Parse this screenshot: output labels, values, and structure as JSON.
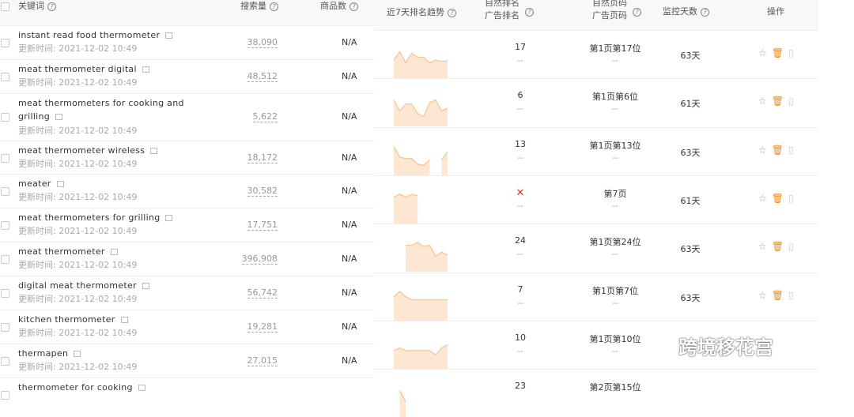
{
  "left_headers": {
    "keyword": "关键词",
    "volume": "搜索量",
    "products": "商品数"
  },
  "right_headers": {
    "trend": "近7天排名趋势",
    "rank1": "自然排名",
    "rank2": "广告排名",
    "page1": "自然页码",
    "page2": "广告页码",
    "days": "监控天数",
    "ops": "操作"
  },
  "help_glyph": "?",
  "update_label": "更新时间: 2021-12-02 10:49",
  "keywords": [
    {
      "kw": "instant read food thermometer",
      "vol": "38,090",
      "prod": "N/A"
    },
    {
      "kw": "meat thermometer digital",
      "vol": "48,512",
      "prod": "N/A"
    },
    {
      "kw": "meat thermometers for cooking and grilling",
      "vol": "5,622",
      "prod": "N/A"
    },
    {
      "kw": "meat thermometer wireless",
      "vol": "18,172",
      "prod": "N/A"
    },
    {
      "kw": "meater",
      "vol": "30,582",
      "prod": "N/A"
    },
    {
      "kw": "meat thermometers for grilling",
      "vol": "17,751",
      "prod": "N/A"
    },
    {
      "kw": "meat thermometer",
      "vol": "396,908",
      "prod": "N/A"
    },
    {
      "kw": "digital meat thermometer",
      "vol": "56,742",
      "prod": "N/A"
    },
    {
      "kw": "kitchen thermometer",
      "vol": "19,281",
      "prod": "N/A"
    },
    {
      "kw": "thermapen",
      "vol": "27,015",
      "prod": "N/A"
    },
    {
      "kw": "thermometer for cooking",
      "vol": "",
      "prod": ""
    }
  ],
  "rankings": [
    {
      "rank": "17",
      "ad": "--",
      "page": "第1页第17位",
      "adpage": "--",
      "days": "63天",
      "trend": [
        0.6,
        0.9,
        0.5,
        0.85,
        0.7,
        0.7,
        0.5,
        0.6,
        0.55,
        0.57
      ]
    },
    {
      "rank": "6",
      "ad": "--",
      "page": "第1页第6位",
      "adpage": "--",
      "days": "61天",
      "trend": [
        0.9,
        0.5,
        0.75,
        0.75,
        0.4,
        0.3,
        0.8,
        0.9,
        0.5,
        0.6
      ]
    },
    {
      "rank": "13",
      "ad": "--",
      "page": "第1页第13位",
      "adpage": "--",
      "days": "63天",
      "trend": [
        1,
        0.6,
        0.55,
        0.55,
        0.35,
        0.3,
        0.5,
        null,
        0.5,
        0.8
      ]
    },
    {
      "rank": "✕",
      "ad": "--",
      "page": "第7页",
      "adpage": "--",
      "days": "61天",
      "trend": [
        0.9,
        1,
        0.9,
        1,
        0.95,
        null,
        null,
        null,
        null,
        null
      ]
    },
    {
      "rank": "24",
      "ad": "--",
      "page": "第1页第24位",
      "adpage": "--",
      "days": "63天",
      "trend": [
        null,
        null,
        0.9,
        0.9,
        1,
        0.85,
        0.9,
        0.5,
        0.65,
        0.55
      ]
    },
    {
      "rank": "7",
      "ad": "--",
      "page": "第1页第7位",
      "adpage": "--",
      "days": "63天",
      "trend": [
        0.8,
        1,
        0.8,
        0.7,
        0.7,
        0.7,
        0.7,
        0.7,
        0.7,
        0.7
      ]
    },
    {
      "rank": "10",
      "ad": "--",
      "page": "第1页第10位",
      "adpage": "--",
      "days": "",
      "trend": [
        0.6,
        0.7,
        0.6,
        0.6,
        0.6,
        0.6,
        0.6,
        0.45,
        0.7,
        0.8
      ]
    },
    {
      "rank": "23",
      "ad": "",
      "page": "第2页第15位",
      "adpage": "",
      "days": "",
      "trend": [
        null,
        0.9,
        0.5,
        null,
        null,
        null,
        null,
        null,
        null,
        null
      ]
    }
  ],
  "colors": {
    "trend_line": "#f9c58f",
    "trend_fill": "#fde7d2",
    "delete": "#f28b1c",
    "cross": "#e8341c"
  },
  "watermark": "跨境移花宫"
}
